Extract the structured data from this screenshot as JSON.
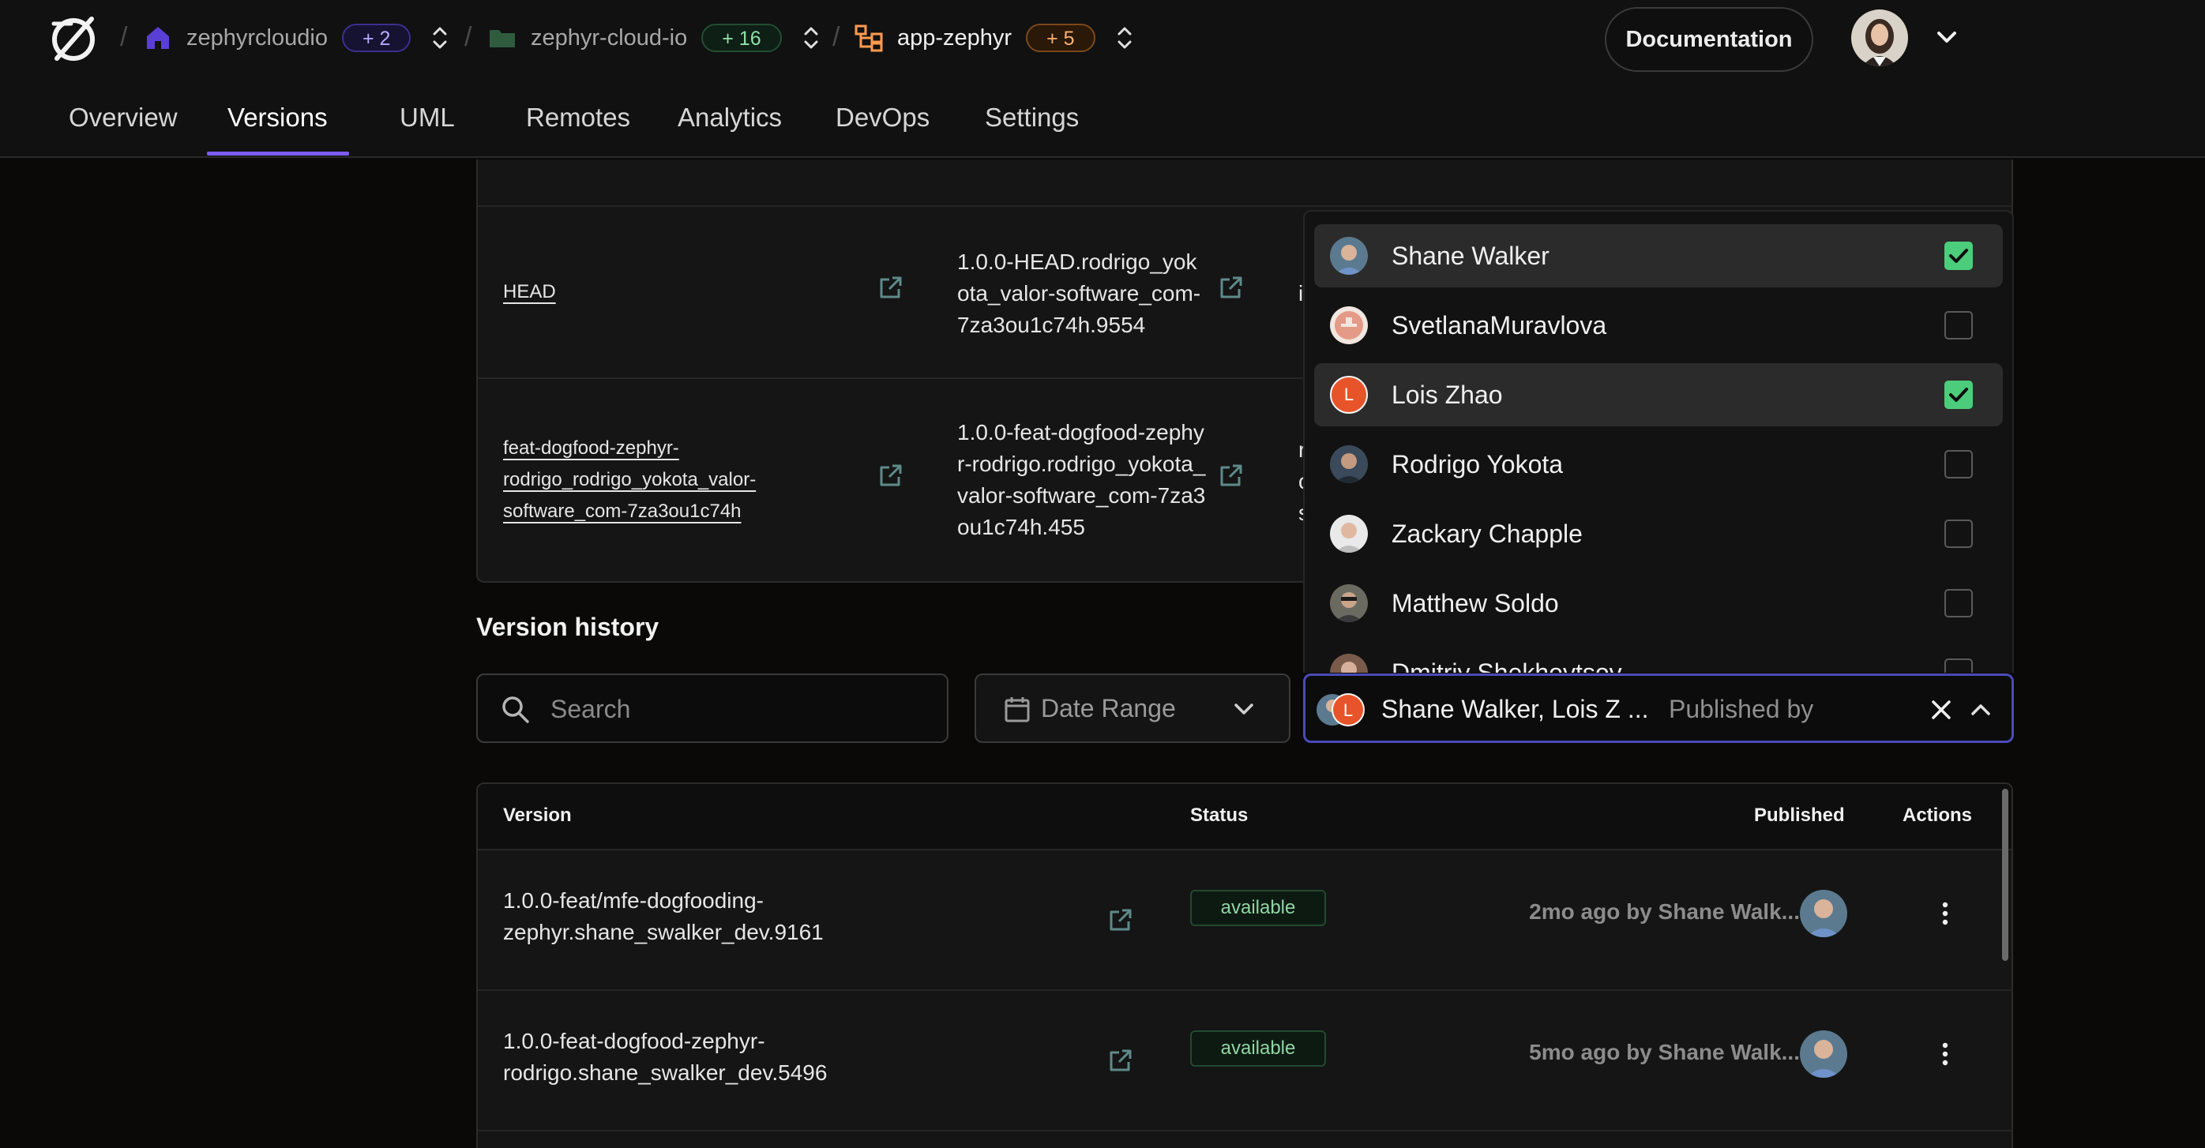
{
  "header": {
    "crumbs": [
      {
        "name": "zephyrcloudio",
        "badge": "+ 2",
        "icon": "home-icon"
      },
      {
        "name": "zephyr-cloud-io",
        "badge": "+ 16",
        "icon": "folder-icon"
      },
      {
        "name": "app-zephyr",
        "badge": "+ 5",
        "icon": "app-tree-icon"
      }
    ],
    "separator": "/",
    "docs_label": "Documentation"
  },
  "tabs": [
    "Overview",
    "Versions",
    "UML",
    "Remotes",
    "Analytics",
    "DevOps",
    "Settings"
  ],
  "active_tab": "Versions",
  "remotes": {
    "rows": [
      {
        "tag": "HEAD",
        "version_lines": [
          "1.0.0-HEAD.rodrigo_yok",
          "ota_valor-software_com-",
          "7za3ou1c74h.9554"
        ],
        "clipped": "i"
      },
      {
        "tag_lines": [
          "feat-dogfood-zephyr-",
          "rodrigo_rodrigo_yokota_valor-",
          "software_com-7za3ou1c74h"
        ],
        "version_lines": [
          "1.0.0-feat-dogfood-zephy",
          "r-rodrigo.rodrigo_yokota_",
          "valor-software_com-7za3",
          "ou1c74h.455"
        ],
        "clipped": [
          "r",
          "c",
          "s"
        ]
      }
    ]
  },
  "version_history": {
    "title": "Version history",
    "search_placeholder": "Search",
    "date_range_label": "Date Range",
    "published_by": {
      "selected_text": "Shane Walker, Lois Z ...",
      "placeholder": "Published by",
      "options": [
        {
          "name": "Shane Walker",
          "checked": true
        },
        {
          "name": "SvetlanaMuravlova",
          "checked": false
        },
        {
          "name": "Lois Zhao",
          "checked": true,
          "initial": "L"
        },
        {
          "name": "Rodrigo Yokota",
          "checked": false
        },
        {
          "name": "Zackary Chapple",
          "checked": false
        },
        {
          "name": "Matthew Soldo",
          "checked": false
        },
        {
          "name": "Dmitriy Shekhovtsov",
          "checked": false
        }
      ]
    },
    "table": {
      "columns": [
        "Version",
        "Status",
        "Published",
        "Actions"
      ],
      "rows": [
        {
          "version_lines": [
            "1.0.0-feat/mfe-dogfooding-",
            "zephyr.shane_swalker_dev.9161"
          ],
          "status": "available",
          "published": "2mo ago by Shane Walk..."
        },
        {
          "version_lines": [
            "1.0.0-feat-dogfood-zephyr-",
            "rodrigo.shane_swalker_dev.5496"
          ],
          "status": "available",
          "published": "5mo ago by Shane Walk..."
        }
      ]
    }
  },
  "colors": {
    "accent": "#7c5cff",
    "check": "#4ccd7c",
    "focus_border": "#4b4bb8",
    "lois_avatar": "#e8542a"
  }
}
